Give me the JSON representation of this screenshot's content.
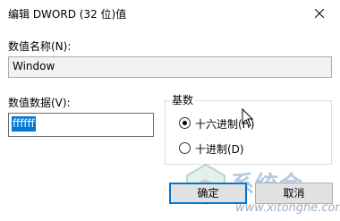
{
  "window": {
    "title": "编辑 DWORD (32 位)值"
  },
  "form": {
    "name_label": "数值名称(N):",
    "name_value": "Window",
    "data_label": "数值数据(V):",
    "data_value": "ffffff"
  },
  "base": {
    "title": "基数",
    "options": [
      {
        "label": "十六进制(H)",
        "selected": true
      },
      {
        "label": "十进制(D)",
        "selected": false
      }
    ]
  },
  "buttons": {
    "ok_label": "确定",
    "cancel_label": "取消"
  },
  "watermark": {
    "text": "系统合",
    "url": "www.xitonghe.com"
  },
  "colors": {
    "accent": "#0078d7",
    "selection_text": "#ffffff"
  }
}
